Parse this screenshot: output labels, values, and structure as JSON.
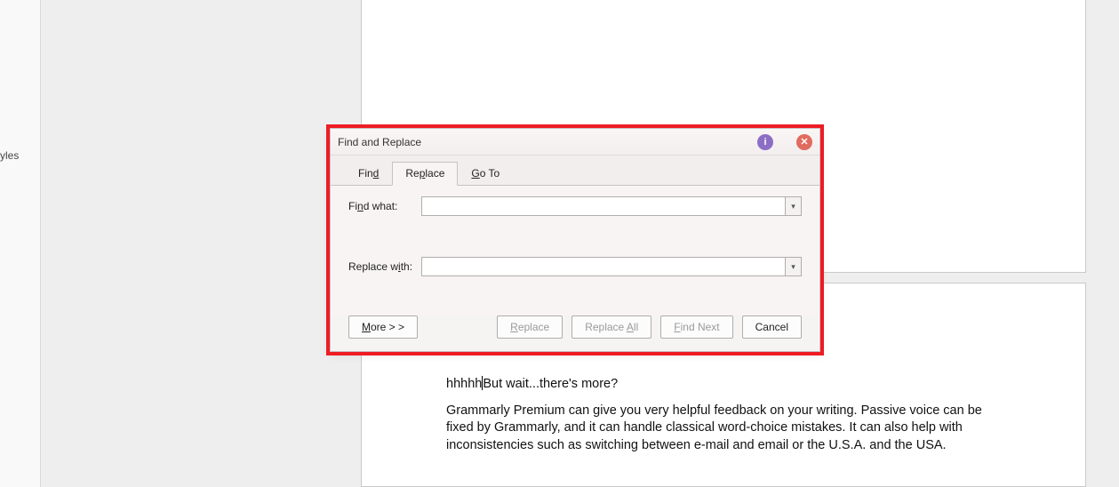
{
  "sidebar": {
    "fragment": "yles"
  },
  "document": {
    "line1a": "hhhhh",
    "line1b": "But wait...there's more?",
    "paragraph": "Grammarly Premium can give you very helpful feedback on your writing. Passive voice can be fixed by Grammarly, and it can handle classical word-choice mistakes. It can also help with inconsistencies such as switching between e-mail and email or the U.S.A. and the USA."
  },
  "dialog": {
    "title": "Find and Replace",
    "helpGlyph": "i",
    "closeGlyph": "✕",
    "tabs": {
      "find": "Find",
      "replace": "Replace",
      "goto": "Go To"
    },
    "activeTab": "replace",
    "findLabelPre": "Fi",
    "findLabelAcc": "n",
    "findLabelPost": "d what:",
    "replaceLabelPre": "Replace w",
    "replaceLabelAcc": "i",
    "replaceLabelPost": "th:",
    "findValue": "",
    "replaceValue": "",
    "dropdownGlyph": "▾",
    "buttons": {
      "morePre": "",
      "moreAcc": "M",
      "morePost": "ore > >",
      "replacePre": "",
      "replaceAcc": "R",
      "replacePost": "eplace",
      "replaceAllPre": "Replace ",
      "replaceAllAcc": "A",
      "replaceAllPost": "ll",
      "findNextPre": "",
      "findNextAcc": "F",
      "findNextPost": "ind Next",
      "cancel": "Cancel"
    }
  }
}
